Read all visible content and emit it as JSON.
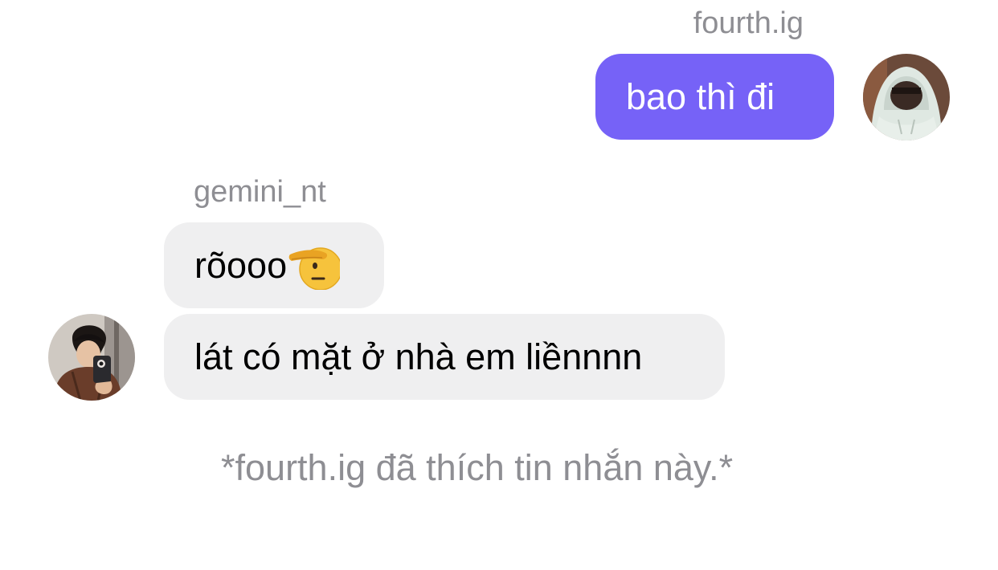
{
  "conversation": {
    "outgoing": {
      "sender": "fourth.ig",
      "message": "bao thì đi",
      "avatar_icon": "avatar-hoodie-icon"
    },
    "incoming": {
      "sender": "gemini_nt",
      "messages": [
        {
          "text": "rõooo",
          "emoji": "saluting-face-emoji"
        },
        {
          "text": "lát có mặt ở nhà em liềnnnn"
        }
      ],
      "avatar_icon": "avatar-mirror-selfie-icon"
    },
    "reaction_note": "*fourth.ig đã thích tin nhắn này.*"
  },
  "colors": {
    "outgoing_bubble": "#7662f7",
    "incoming_bubble": "#efeff0",
    "muted_text": "#8e8e93"
  }
}
